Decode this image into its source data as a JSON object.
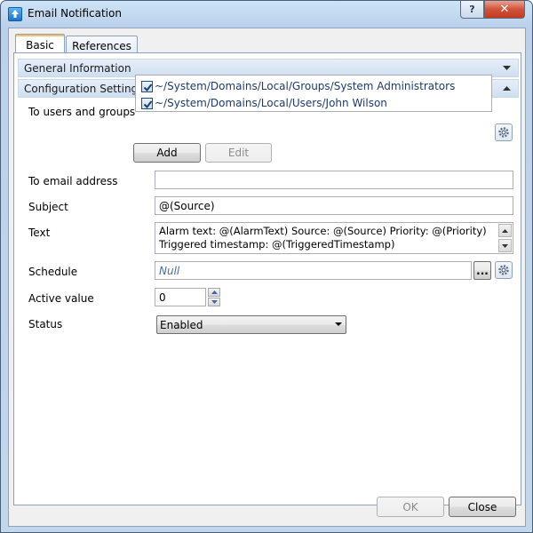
{
  "window": {
    "title": "Email Notification",
    "help_label": "?",
    "close_label": "✕"
  },
  "tabs": [
    {
      "label": "Basic",
      "active": true
    },
    {
      "label": "References",
      "active": false
    }
  ],
  "sections": {
    "general": "General Information",
    "config": "Configuration Settings"
  },
  "form": {
    "to_users_label": "To users and groups",
    "users": [
      {
        "path": "~/System/Domains/Local/Groups/System Administrators",
        "checked": true
      },
      {
        "path": "~/System/Domains/Local/Users/John Wilson",
        "checked": true
      }
    ],
    "add_label": "Add",
    "edit_label": "Edit",
    "email_label": "To email address",
    "email_value": "",
    "subject_label": "Subject",
    "subject_value": "@(Source)",
    "text_label": "Text",
    "text_line1": "Alarm text: @(AlarmText) Source: @(Source) Priority: @(Priority)",
    "text_line2": "Triggered timestamp: @(TriggeredTimestamp)",
    "schedule_label": "Schedule",
    "schedule_placeholder": "Null",
    "browse_label": "...",
    "active_label": "Active value",
    "active_value": "0",
    "status_label": "Status",
    "status_value": "Enabled"
  },
  "footer": {
    "ok_label": "OK",
    "close_label": "Close"
  },
  "colors": {
    "title_gradient_top": "#cde3f6",
    "section_header": "#dce8f5",
    "link_text": "#1c3a6a",
    "close_button_red": "#c23b20"
  }
}
